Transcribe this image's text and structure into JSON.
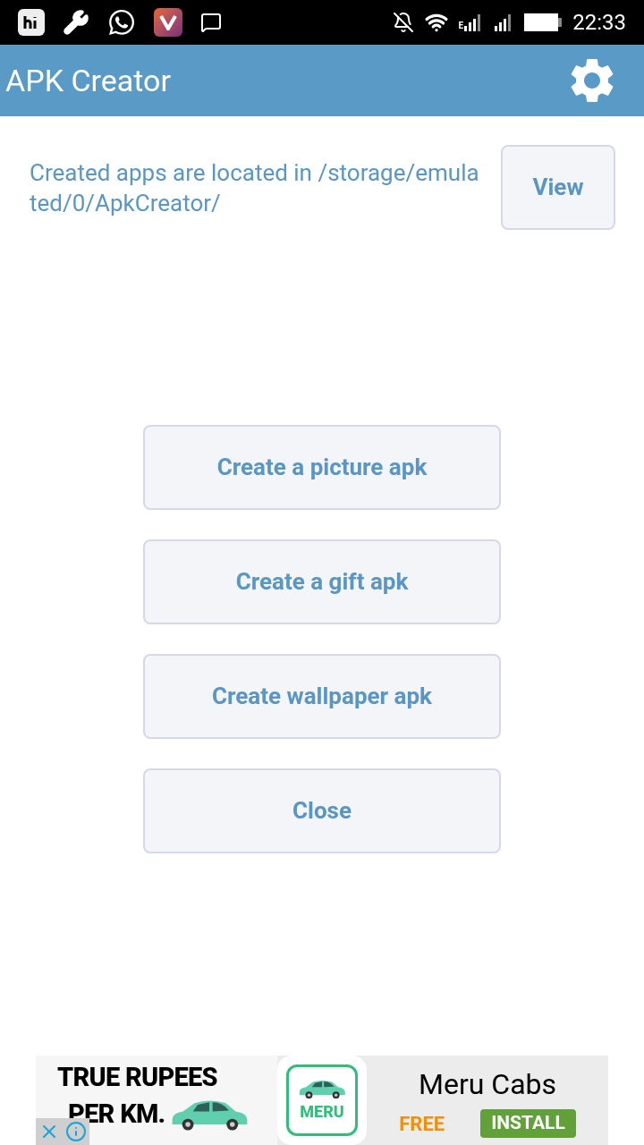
{
  "status_bar": {
    "network_type": "E",
    "time": "22:33"
  },
  "app_bar": {
    "title": "APK Creator"
  },
  "location": {
    "text": "Created apps are located in /storage/emulated/0/ApkCreator/",
    "button": "View"
  },
  "buttons": [
    "Create a picture apk",
    "Create a gift apk",
    "Create wallpaper apk",
    "Close"
  ],
  "ad": {
    "headline_1": "TRUE RUPEES",
    "headline_2": "PER KM.",
    "logo": "MERU",
    "app_name": "Meru Cabs",
    "price": "FREE",
    "install": "INSTALL"
  }
}
